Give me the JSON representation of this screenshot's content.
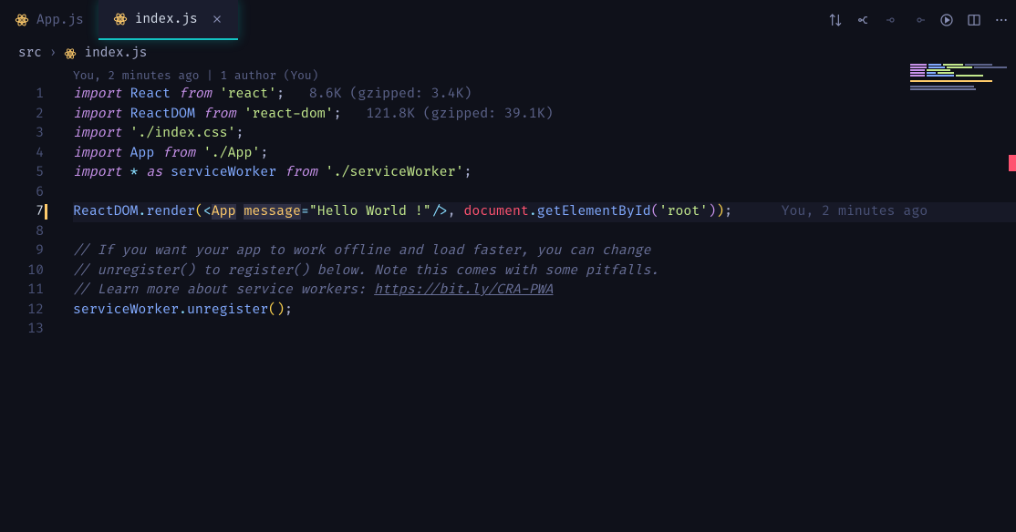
{
  "tabs": [
    {
      "label": "App.js",
      "active": false
    },
    {
      "label": "index.js",
      "active": true
    }
  ],
  "breadcrumb": {
    "folder": "src",
    "file": "index.js"
  },
  "author_line": "You, 2 minutes ago | 1 author (You)",
  "blame_inline": "You, 2 minutes ago",
  "lines": {
    "l1": {
      "import": "import",
      "name": "React",
      "from": "from",
      "path": "'react'",
      "hint": "8.6K (gzipped: 3.4K)"
    },
    "l2": {
      "import": "import",
      "name": "ReactDOM",
      "from": "from",
      "path": "'react-dom'",
      "hint": "121.8K (gzipped: 39.1K)"
    },
    "l3": {
      "import": "import",
      "path": "'./index.css'"
    },
    "l4": {
      "import": "import",
      "name": "App",
      "from": "from",
      "path": "'./App'"
    },
    "l5": {
      "import": "import",
      "star": "*",
      "as": "as",
      "name": "serviceWorker",
      "from": "from",
      "path": "'./serviceWorker'"
    },
    "l7": {
      "obj": "ReactDOM",
      "fn": "render",
      "tag": "App",
      "attr": "message",
      "val": "\"Hello World !\"",
      "doc": "document",
      "gbi": "getElementById",
      "root": "'root'"
    },
    "l9": "// If you want your app to work offline and load faster, you can change",
    "l10": "// unregister() to register() below. Note this comes with some pitfalls.",
    "l11_pre": "// Learn more about service workers: ",
    "l11_link": "https://bit.ly/CRA-PWA",
    "l12": {
      "obj": "serviceWorker",
      "fn": "unregister"
    }
  },
  "line_numbers": [
    1,
    2,
    3,
    4,
    5,
    6,
    7,
    8,
    9,
    10,
    11,
    12,
    13
  ]
}
